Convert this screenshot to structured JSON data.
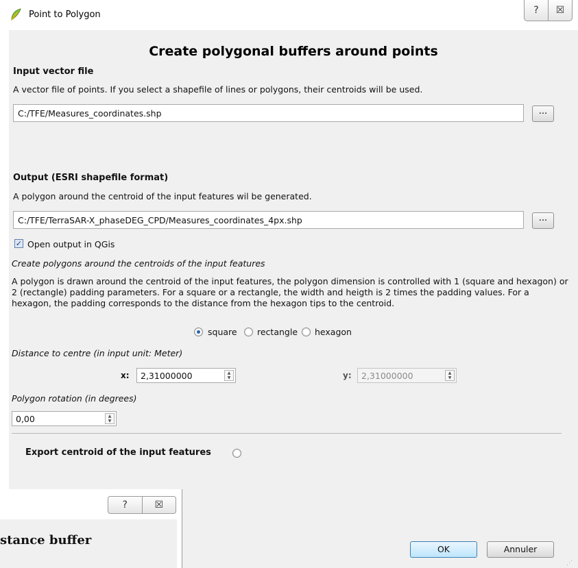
{
  "window": {
    "title": "Point to Polygon",
    "help_button": "?",
    "close_button": "☒"
  },
  "header": {
    "title": "Create polygonal buffers around points"
  },
  "input": {
    "label": "Input vector file",
    "description": "A vector file of points. If you select a shapefile of lines or polygons, their centroids will be used.",
    "path": "C:/TFE/Measures_coordinates.shp",
    "browse_label": "..."
  },
  "output": {
    "label": "Output (ESRI shapefile format)",
    "description": "A polygon around the centroid of the input features wil be generated.",
    "path": "C:/TFE/TerraSAR-X_phaseDEG_CPD/Measures_coordinates_4px.shp",
    "browse_label": "...",
    "open_checkbox_label": "Open output  in QGis",
    "open_checked": true
  },
  "polygons": {
    "section_label": "Create polygons around the centroids of the input features",
    "description": "A polygon is drawn around the centroid of the input features, the polygon dimension is controlled with 1 (square and hexagon) or 2 (rectangle) padding parameters. For a square or a rectangle, the width and heigth is 2 times the padding values. For a hexagon, the padding corresponds to the distance from the hexagon tips to the centroid.",
    "shapes": [
      {
        "label": "square",
        "selected": true
      },
      {
        "label": "rectangle",
        "selected": false
      },
      {
        "label": "hexagon",
        "selected": false
      }
    ],
    "distance_label": "Distance to centre (in input unit: Meter)",
    "x_label": "x:",
    "x_value": "2,31000000",
    "y_label": "y:",
    "y_value": "2,31000000",
    "rotation_label": "Polygon rotation (in degrees)",
    "rotation_value": "0,00"
  },
  "export": {
    "label": "Export centroid of the input features",
    "selected": false
  },
  "buttons": {
    "ok": "OK",
    "cancel": "Annuler"
  },
  "background_window": {
    "help_button": "?",
    "close_button": "☒",
    "heading": "stance buffer"
  },
  "colors": {
    "dialog_bg": "#f0f0f0",
    "accent": "#3c7fb1",
    "app_icon": "#8cc63f"
  }
}
